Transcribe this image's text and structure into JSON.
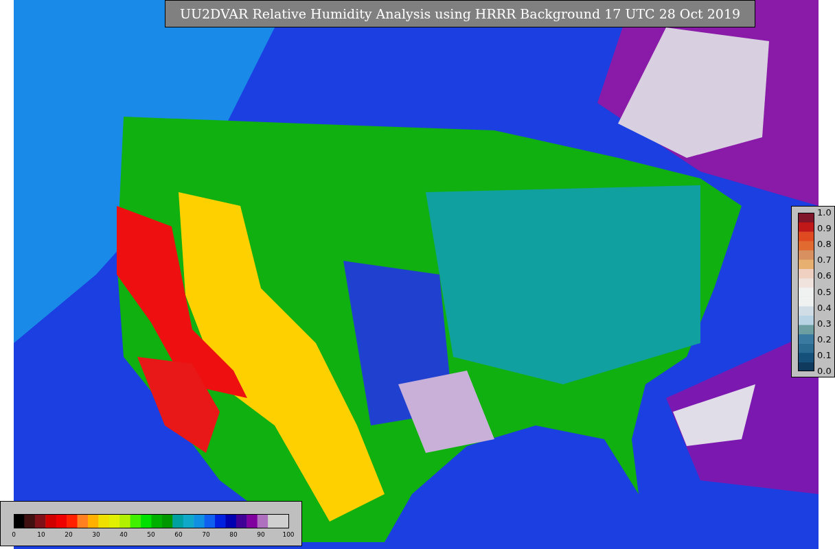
{
  "title": "UU2DVAR Relative Humidity Analysis using HRRR Background 17 UTC 28 Oct 2019",
  "scale_right": {
    "ticks": [
      "1.0",
      "0.9",
      "0.8",
      "0.7",
      "0.6",
      "0.5",
      "0.4",
      "0.3",
      "0.2",
      "0.1",
      "0.0"
    ]
  },
  "scale_bottom": {
    "ticks": [
      "0",
      "10",
      "20",
      "30",
      "40",
      "50",
      "60",
      "70",
      "80",
      "90",
      "100"
    ]
  }
}
